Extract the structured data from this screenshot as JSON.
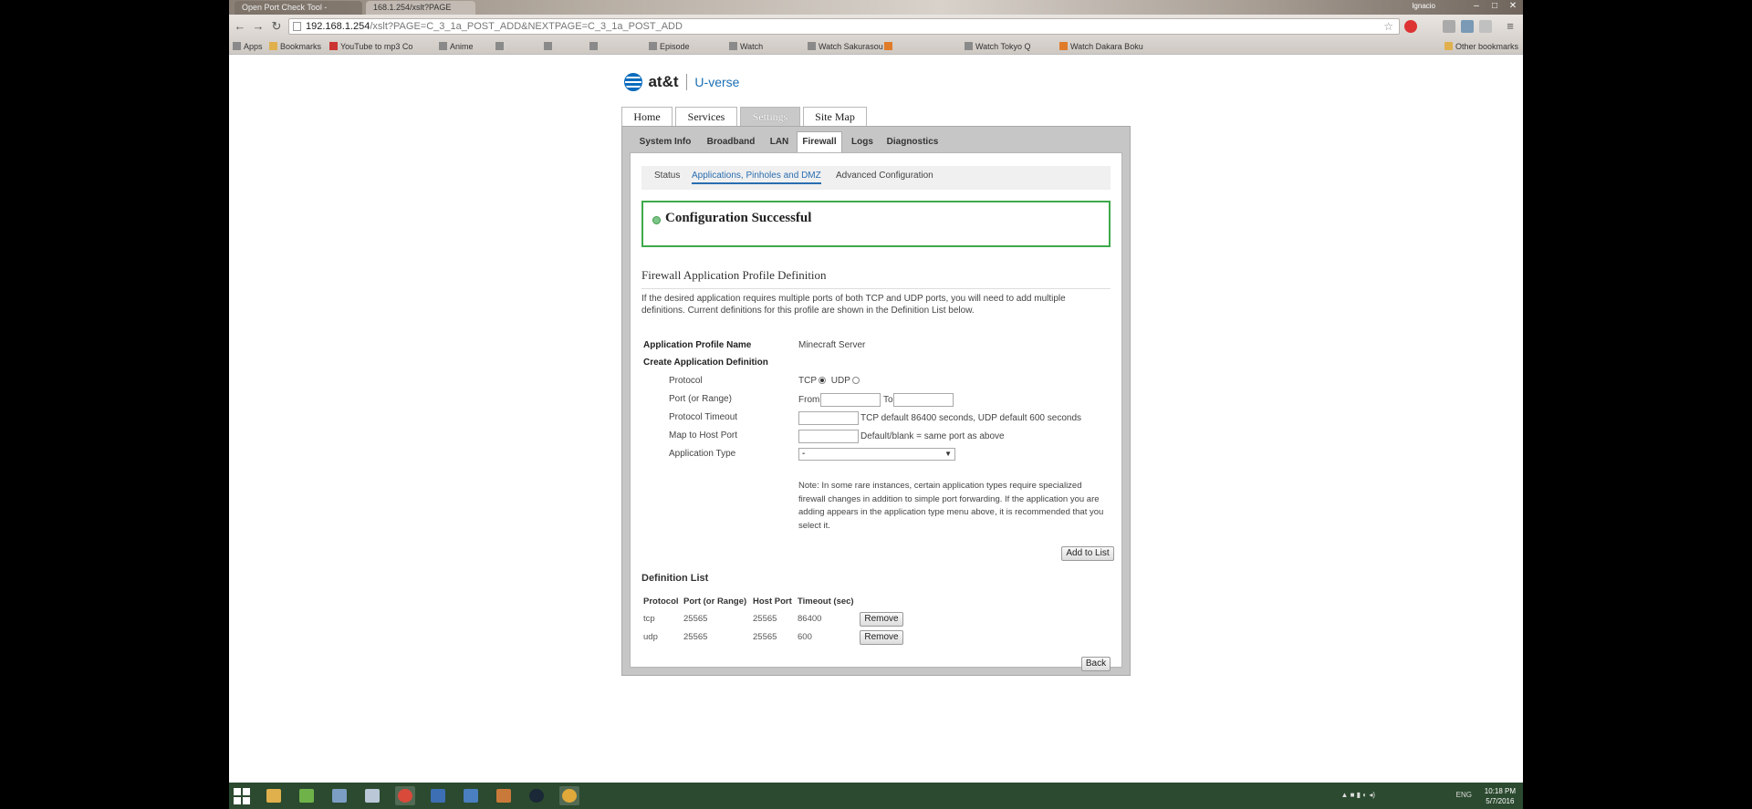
{
  "browser": {
    "tabs": [
      "Open Port Check Tool -",
      "168.1.254/xslt?PAGE"
    ],
    "user": "Ignacio",
    "url_host": "192.168.1.254",
    "url_rest": "/xslt?PAGE=C_3_1a_POST_ADD&NEXTPAGE=C_3_1a_POST_ADD",
    "bookmarks": [
      {
        "label": "Apps"
      },
      {
        "label": "Bookmarks"
      },
      {
        "label": "YouTube to mp3 Co"
      },
      {
        "label": "Anime"
      },
      {
        "label": "Episode"
      },
      {
        "label": "Watch"
      },
      {
        "label": "Watch Sakurasou"
      },
      {
        "label": "Watch Tokyo Q"
      },
      {
        "label": "Watch Dakara Boku"
      }
    ],
    "other_bookmarks": "Other bookmarks"
  },
  "logo": {
    "brand": "at&t",
    "product": "U-verse"
  },
  "top_tabs": [
    "Home",
    "Services",
    "Settings",
    "Site Map"
  ],
  "sub_tabs": [
    "System Info",
    "Broadband",
    "LAN",
    "Firewall",
    "Logs",
    "Diagnostics"
  ],
  "link_tabs": [
    "Status",
    "Applications, Pinholes and DMZ",
    "Advanced Configuration"
  ],
  "success_message": "Configuration Successful",
  "section_title": "Firewall Application Profile Definition",
  "description": "If the desired application requires multiple ports of both TCP and UDP ports, you will need to add multiple definitions. Current definitions for this profile are shown in the Definition List below.",
  "form": {
    "profile_name_label": "Application Profile Name",
    "profile_name_value": "Minecraft Server",
    "create_label": "Create Application Definition",
    "protocol_label": "Protocol",
    "tcp": "TCP",
    "udp": "UDP",
    "port_label": "Port (or Range)",
    "from": "From",
    "to": "To",
    "timeout_label": "Protocol Timeout",
    "timeout_hint": "TCP default 86400 seconds, UDP default 600 seconds",
    "map_label": "Map to Host Port",
    "map_hint": "Default/blank = same port as above",
    "app_type_label": "Application Type",
    "app_type_value": "-",
    "note": "Note: In some rare instances, certain application types require specialized firewall changes in addition to simple port forwarding. If the application you are adding appears in the application type menu above, it is recommended that you select it.",
    "add_button": "Add to List"
  },
  "definition_list": {
    "title": "Definition List",
    "headers": [
      "Protocol",
      "Port (or Range)",
      "Host Port",
      "Timeout (sec)"
    ],
    "rows": [
      {
        "protocol": "tcp",
        "port": "25565",
        "host_port": "25565",
        "timeout": "86400",
        "action": "Remove"
      },
      {
        "protocol": "udp",
        "port": "25565",
        "host_port": "25565",
        "timeout": "600",
        "action": "Remove"
      }
    ]
  },
  "back_button": "Back",
  "taskbar": {
    "lang": "ENG",
    "time": "10:18 PM",
    "date": "5/7/2016"
  }
}
